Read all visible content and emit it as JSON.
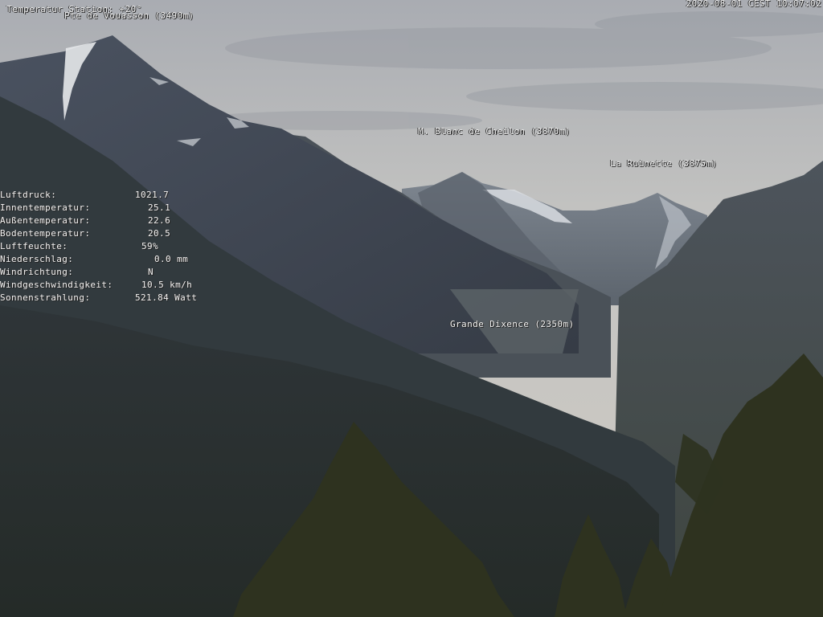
{
  "overlay": {
    "station_temp": "Temperatur Station: +20°",
    "peak_label": "Pte de Vouasson (3490m)",
    "timestamp": "2020-08-01 CEST 10:07:02"
  },
  "annotations": [
    {
      "id": "mont-blanc-de-cheilon",
      "text": "M. Blanc de Cheilon (3870m)"
    },
    {
      "id": "la-ruinette",
      "text": "La Ruinette (3875m)"
    },
    {
      "id": "grande-dixence",
      "text": "Grande Dixence (2350m)"
    }
  ],
  "weather": [
    {
      "label": "Luftdruck:",
      "value": "1021.7"
    },
    {
      "label": "Innentemperatur:",
      "value": "25.1"
    },
    {
      "label": "Außentemperatur:",
      "value": "22.6"
    },
    {
      "label": "Bodentemperatur:",
      "value": "20.5"
    },
    {
      "label": "Luftfeuchte:",
      "value": "59%"
    },
    {
      "label": "Niederschlag:",
      "value": "0.0 mm"
    },
    {
      "label": "Windrichtung:",
      "value": "N"
    },
    {
      "label": "Windgeschwindigkeit:",
      "value": "10.5 km/h"
    },
    {
      "label": "Sonnenstrahlung:",
      "value": "521.84 Watt"
    }
  ],
  "colors": {
    "sky_top": "#b4b6ba",
    "sky_bottom": "#cbc9c4",
    "far_ridge": "#6a7078",
    "left_peak": "#3e4450",
    "mid_slope": "#333a40",
    "foreground_forest": "#262c27",
    "trees": "#2f3323"
  }
}
